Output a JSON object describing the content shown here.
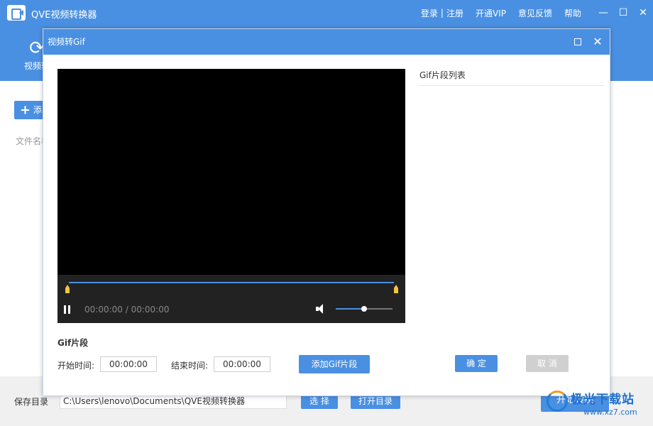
{
  "app": {
    "title": "QVE视频转换器",
    "header_links": {
      "login": "登录",
      "separator": "|",
      "register": "注册",
      "vip": "开通VIP",
      "feedback": "意见反馈",
      "help": "帮助"
    },
    "window_controls": {
      "minimize": "—",
      "maximize": "☐",
      "close": "✕"
    }
  },
  "toolbar": {
    "tool_label": "视频转"
  },
  "workarea": {
    "add_button_label": "添",
    "filename_column": "文件名称"
  },
  "bottom": {
    "save_dir_label": "保存目录",
    "save_path": "C:\\Users\\lenovo\\Documents\\QVE视频转换器",
    "pick_button": "选 择",
    "open_dir_button": "打开目录",
    "convert_button": "开始转换"
  },
  "dialog": {
    "title": "视频转Gif",
    "close_glyph": "✕",
    "player": {
      "time_display": "00:00:00 / 00:00:00",
      "volume_level": 0.5
    },
    "gif_list_header": "Gif片段列表",
    "segment": {
      "title": "Gif片段",
      "start_label": "开始时间:",
      "start_value": "00:00:00",
      "end_label": "结束时间:",
      "end_value": "00:00:00",
      "add_button": "添加Gif片段"
    },
    "ok_button": "确 定",
    "cancel_button": "取 消"
  },
  "watermark": {
    "text": "极光下载站",
    "url": "www.xz7.com"
  },
  "colors": {
    "accent": "#4a90e2",
    "marker": "#f5c342",
    "disabled": "#d0d0d0"
  }
}
